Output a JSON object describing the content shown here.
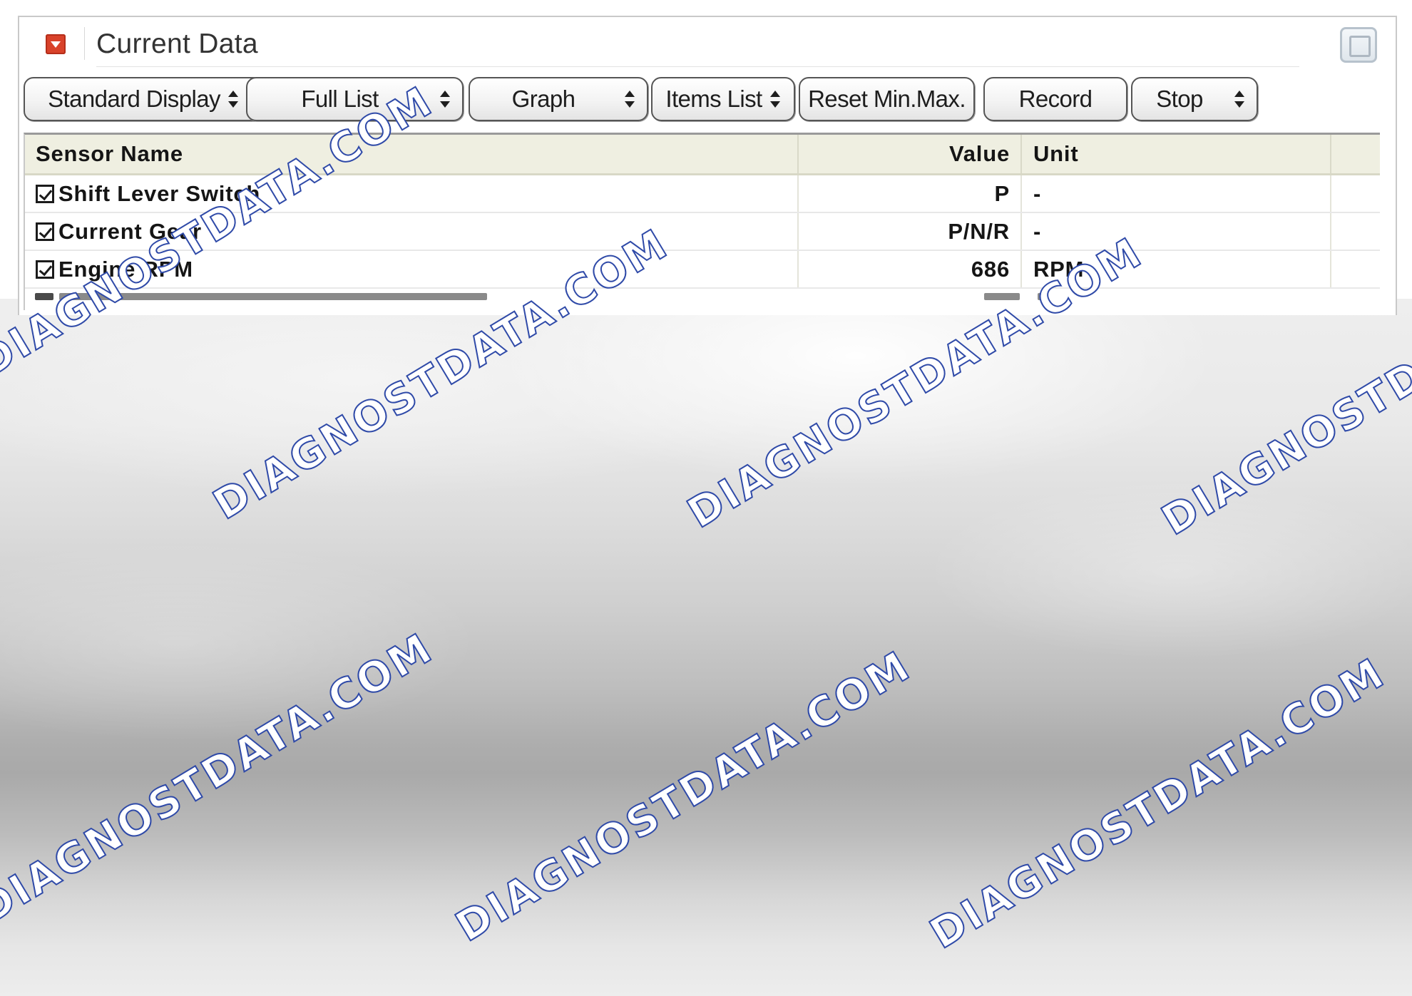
{
  "panel": {
    "title": "Current Data",
    "collapse_icon": "collapse-arrow-icon",
    "window_icon": "restore-window-icon"
  },
  "toolbar": {
    "buttons": [
      {
        "label": "Standard Display",
        "type": "select"
      },
      {
        "label": "Full List",
        "type": "select"
      },
      {
        "label": "Graph",
        "type": "select"
      },
      {
        "label": "Items List",
        "type": "select"
      },
      {
        "label": "Reset Min.Max.",
        "type": "button"
      },
      {
        "label": "Record",
        "type": "button"
      },
      {
        "label": "Stop",
        "type": "select"
      }
    ]
  },
  "table": {
    "headers": {
      "name": "Sensor Name",
      "value": "Value",
      "unit": "Unit"
    },
    "rows": [
      {
        "checked": true,
        "name": "Shift Lever Switch",
        "value": "P",
        "unit": "-"
      },
      {
        "checked": true,
        "name": "Current Gear",
        "value": "P/N/R",
        "unit": "-"
      },
      {
        "checked": true,
        "name": "Engine RPM",
        "value": "686",
        "unit": "RPM"
      }
    ]
  },
  "watermark": {
    "text_a": "DIAGNOSTDATA.COM",
    "color": "#2f4aa8"
  }
}
